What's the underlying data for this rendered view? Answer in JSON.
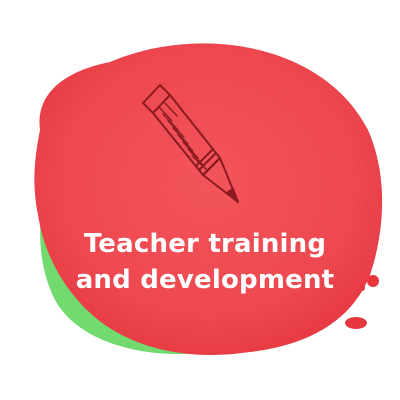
{
  "caption": {
    "line1": "Teacher training",
    "line2": "and development"
  },
  "icons": {
    "main": "pencil-icon"
  },
  "colors": {
    "blob_red": "#f04a52",
    "blob_red_dark": "#e73a44",
    "blob_green": "#5ed35a",
    "pencil_stroke": "#8a1c20",
    "text": "#ffffff"
  }
}
